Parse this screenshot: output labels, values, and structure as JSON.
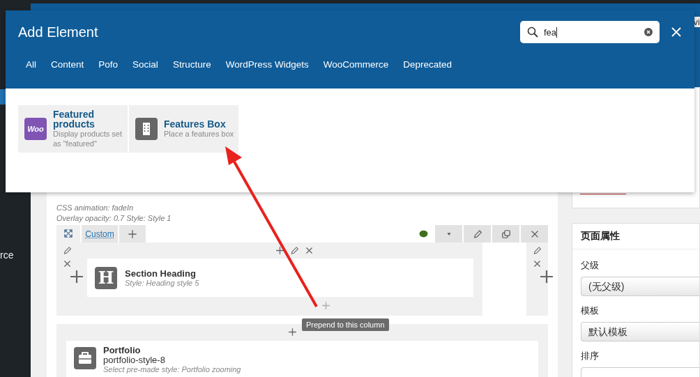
{
  "admin_sidebar": {
    "partial_label": "rce"
  },
  "top_bar": {
    "partial_text": "vi"
  },
  "modal": {
    "title": "Add Element",
    "search": {
      "value": "fea"
    },
    "tabs": [
      {
        "label": "All",
        "selected": false
      },
      {
        "label": "Content",
        "selected": false
      },
      {
        "label": "Pofo",
        "selected": false
      },
      {
        "label": "Social",
        "selected": false
      },
      {
        "label": "Structure",
        "selected": false
      },
      {
        "label": "WordPress Widgets",
        "selected": false
      },
      {
        "label": "WooCommerce",
        "selected": false
      },
      {
        "label": "Deprecated",
        "selected": false
      }
    ],
    "results": [
      {
        "kind": "woo",
        "icon_text": "Woo",
        "title": "Featured products",
        "description": "Display products set as \"featured\""
      },
      {
        "kind": "building",
        "title": "Features Box",
        "description": "Place a features box"
      }
    ]
  },
  "editor": {
    "notes": [
      "CSS animation: fadeIn",
      "Overlay opacity: 0.7  Style: Style 1"
    ],
    "row": {
      "layout_label": "Custom",
      "element": {
        "icon_text": "H",
        "title": "Section Heading",
        "subtitle": "Style: Heading style 5"
      }
    },
    "row2": {
      "element": {
        "title": "Portfolio",
        "line2": "portfolio-style-8",
        "subtitle": "Select pre-made style: Portfolio zooming"
      }
    },
    "tooltip": "Prepend to this column"
  },
  "page_attributes": {
    "title": "页面属性",
    "fields": [
      {
        "label": "父级",
        "kind": "select",
        "value": "(无父级)"
      },
      {
        "label": "模板",
        "kind": "select",
        "value": "默认模板"
      },
      {
        "label": "排序",
        "kind": "input"
      }
    ]
  }
}
